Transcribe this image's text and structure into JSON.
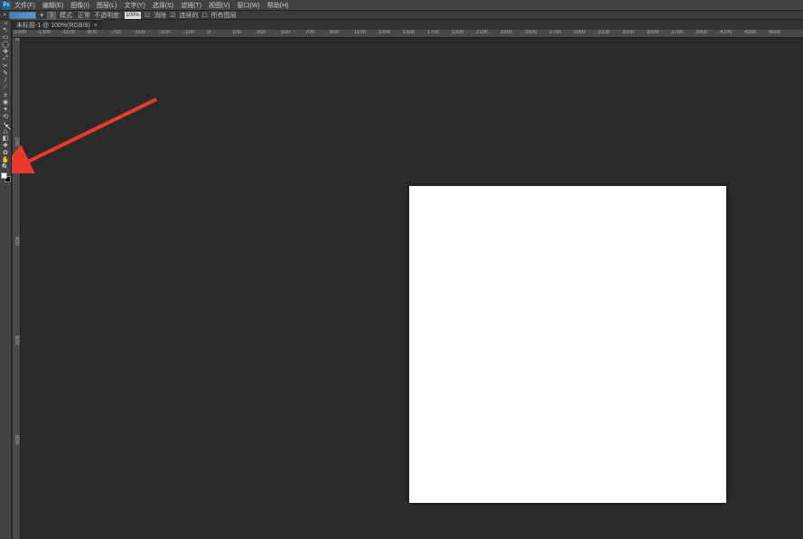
{
  "app": {
    "logo": "Ps"
  },
  "menu": [
    {
      "label": "文件(F)"
    },
    {
      "label": "编辑(E)"
    },
    {
      "label": "图像(I)"
    },
    {
      "label": "图层(L)"
    },
    {
      "label": "文字(Y)"
    },
    {
      "label": "选择(S)"
    },
    {
      "label": "滤镜(T)"
    },
    {
      "label": "视图(V)"
    },
    {
      "label": "窗口(W)"
    },
    {
      "label": "帮助(H)"
    }
  ],
  "options": {
    "fill_prefix": "▪",
    "fill_dropdown": "▾",
    "spacer1": "",
    "num1": "3",
    "mode_label": "模式:",
    "mode_value": "正常",
    "opacity_label": "不透明度:",
    "opacity_value": "100%",
    "flow_chk": "☑",
    "flow_label": "消除",
    "contig_chk": "☑",
    "contig_label": "连续的",
    "all_chk": "☐",
    "all_label": "所有图层"
  },
  "tab": {
    "title": "未标题-1 @ 100%(RGB/8)",
    "close": "×"
  },
  "tools": [
    "↖",
    "▭",
    "◯",
    "✥",
    "⤢",
    "✂",
    "✎",
    "/",
    "⟋",
    "±",
    "◉",
    "✦",
    "⟲",
    "◐",
    "△",
    "◧",
    "❖",
    "✿",
    "✋",
    "🔍"
  ],
  "zoom_label": "",
  "ruler_h": [
    "-1500",
    "-1300",
    "-1100",
    "-900",
    "-700",
    "-500",
    "-300",
    "-100",
    "0",
    "100",
    "300",
    "500",
    "700",
    "900",
    "1100",
    "1300",
    "1500",
    "1700",
    "1900",
    "2100",
    "2300",
    "2500",
    "2700",
    "2900",
    "3100",
    "3300",
    "3500",
    "3700",
    "3900",
    "4100",
    "4300",
    "4500"
  ],
  "ruler_v": [
    "0",
    "200",
    "400",
    "600",
    "800"
  ],
  "annotation": {
    "arrow_color": "#e83a2a"
  }
}
